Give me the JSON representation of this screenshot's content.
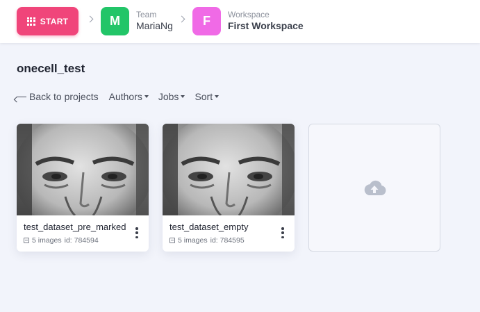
{
  "topbar": {
    "start_label": "START",
    "team": {
      "caption": "Team",
      "name": "MariaNg",
      "initial": "M",
      "color": "#22c568"
    },
    "workspace": {
      "caption": "Workspace",
      "name": "First Workspace",
      "initial": "F",
      "color": "#f06ae6"
    },
    "start_color": "#f0457a"
  },
  "project": {
    "title": "onecell_test"
  },
  "nav": {
    "back_label": "Back to projects",
    "authors_label": "Authors",
    "jobs_label": "Jobs",
    "sort_label": "Sort"
  },
  "datasets": [
    {
      "name": "test_dataset_pre_marked",
      "images": "5 images",
      "id": "id: 784594"
    },
    {
      "name": "test_dataset_empty",
      "images": "5 images",
      "id": "id: 784595"
    }
  ],
  "upload": {
    "icon": "cloud-upload-icon"
  }
}
